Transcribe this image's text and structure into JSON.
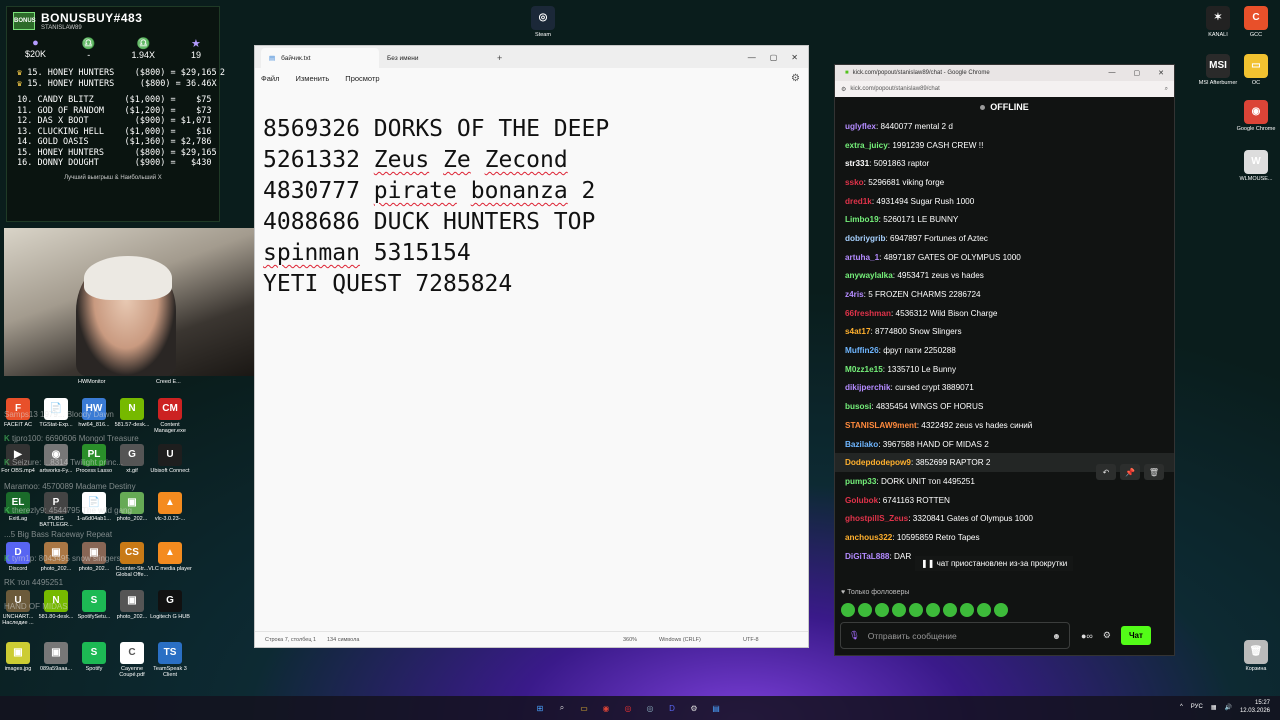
{
  "overlay": {
    "title": "BONUSBUY#483",
    "subtitle": "STANISLAW89",
    "logo": "BONUS",
    "stats": [
      {
        "icon": "●",
        "value": "$20K"
      },
      {
        "icon": "♎",
        "value": "-"
      },
      {
        "icon": "♎",
        "value": "1.94X"
      },
      {
        "icon": "★",
        "value": "19"
      }
    ],
    "best_lines": [
      "15. HONEY HUNTERS    ($800) = $29,165",
      "15. HONEY HUNTERS     ($800) = 36.46X"
    ],
    "best_marker": "2",
    "list_lines": [
      "10. CANDY BLITZ      ($1,000) =    $75",
      "11. GOD OF RANDOM    ($1,200) =    $73",
      "12. DAS X BOOT         ($900) = $1,071",
      "13. CLUCKING HELL    ($1,000) =    $16",
      "14. GOLD OASIS       ($1,360) = $2,786",
      "15. HONEY HUNTERS      ($800) = $29,165",
      "16. DONNY DOUGHT       ($900) =   $430"
    ],
    "footer": "Лучший выигрыш & Наибольший X"
  },
  "desktop_left": {
    "top_labels": [
      "HWMonitor",
      "Creed E..."
    ],
    "icons": [
      {
        "label": "FACEIT AC",
        "glyph": "F",
        "color": "#e8502a"
      },
      {
        "label": "TGStat-Exp...",
        "glyph": "📄",
        "color": "#ffffff"
      },
      {
        "label": "hwi64_816...",
        "glyph": "HW",
        "color": "#3a7bd5"
      },
      {
        "label": "581.57-desk...",
        "glyph": "N",
        "color": "#76b900"
      },
      {
        "label": "Content Manager.exe",
        "glyph": "CM",
        "color": "#c22"
      },
      {
        "label": "For OBS.mp4",
        "glyph": "▶",
        "color": "#333"
      },
      {
        "label": "artworks-Fy...",
        "glyph": "◉",
        "color": "#777"
      },
      {
        "label": "Process Lasso",
        "glyph": "PL",
        "color": "#2a8f2a"
      },
      {
        "label": "xt.gif",
        "glyph": "G",
        "color": "#555"
      },
      {
        "label": "Ubisoft Connect",
        "glyph": "U",
        "color": "#1e1e1e"
      },
      {
        "label": "ExitLag",
        "glyph": "EL",
        "color": "#1a6b2a"
      },
      {
        "label": "PUBG BATTLEGR...",
        "glyph": "P",
        "color": "#444"
      },
      {
        "label": "1-a6d04ab1...",
        "glyph": "📄",
        "color": "#ffffff"
      },
      {
        "label": "photo_202...",
        "glyph": "▣",
        "color": "#6a5"
      },
      {
        "label": "vlc-3.0.23-...",
        "glyph": "▲",
        "color": "#f48b1f"
      },
      {
        "label": "Discord",
        "glyph": "D",
        "color": "#5865f2"
      },
      {
        "label": "photo_202...",
        "glyph": "▣",
        "color": "#a74"
      },
      {
        "label": "photo_202...",
        "glyph": "▣",
        "color": "#865"
      },
      {
        "label": "Counter-Str... Global Offe...",
        "glyph": "CS",
        "color": "#c87a16"
      },
      {
        "label": "VLC media player",
        "glyph": "▲",
        "color": "#f48b1f"
      },
      {
        "label": "UNCHART... Наследие ...",
        "glyph": "U",
        "color": "#6b5a3a"
      },
      {
        "label": "581.80-desk...",
        "glyph": "N",
        "color": "#76b900"
      },
      {
        "label": "SpotifySetu...",
        "glyph": "S",
        "color": "#1db954"
      },
      {
        "label": "photo_202...",
        "glyph": "▣",
        "color": "#555"
      },
      {
        "label": "Logitech G HUB",
        "glyph": "G",
        "color": "#111"
      },
      {
        "label": "images.jpg",
        "glyph": "▣",
        "color": "#cc3"
      },
      {
        "label": "089a59aaa...",
        "glyph": "▣",
        "color": "#777"
      },
      {
        "label": "Spotify",
        "glyph": "S",
        "color": "#1db954"
      },
      {
        "label": "Cayenne Coupé.pdf",
        "glyph": "C",
        "color": "#fff"
      },
      {
        "label": "TeamSpeak 3 Client",
        "glyph": "TS",
        "color": "#2a6fc4"
      }
    ],
    "ghost_chat": [
      {
        "u": "",
        "t": "Samps13 1979... Bloody Dawn"
      },
      {
        "u": "K",
        "t": "tjpro100: 6690606 Mongol Treasure"
      },
      {
        "u": "K",
        "t": "Seizure: ...8314 Twilight princ..."
      },
      {
        "u": "",
        "t": "Maramoo: 4570089 Madame Destiny"
      },
      {
        "u": "K",
        "t": "therezly9: 4544795 The wild gang"
      },
      {
        "u": "",
        "t": "...5 Big Bass Raceway Repeat"
      },
      {
        "u": "K",
        "t": "tyrn1p: 8043495 snow slingers"
      },
      {
        "u": "",
        "t": "RK топ 4495251"
      },
      {
        "u": "",
        "t": "HAND OF MIDAS"
      }
    ],
    "steam_label": "Steam"
  },
  "notepad": {
    "tabs": [
      {
        "label": "байчик.txt"
      },
      {
        "label": "Без имени"
      }
    ],
    "add_tab": "+",
    "menu": [
      "Файл",
      "Изменить",
      "Просмотр"
    ],
    "lines": [
      {
        "pre": "8569326 DORKS OF THE DEEP",
        "sq": []
      },
      {
        "pre": "5261332 ",
        "sq": [
          "Zeus",
          " ",
          "Ze",
          " ",
          "Zecond"
        ]
      },
      {
        "pre": "4830777 ",
        "sq": [
          "pirate",
          " ",
          "bonanza"
        ],
        "post": " 2"
      },
      {
        "pre": "4088686 DUCK HUNTERS TOP",
        "sq": []
      },
      {
        "pre": "",
        "sq": [
          "spinman"
        ],
        "post": " 5315154"
      },
      {
        "pre": "YETI QUEST 7285824",
        "sq": []
      }
    ],
    "status": {
      "position": "Строка 7, столбец 1",
      "chars": "134 символа",
      "zoom": "360%",
      "eol": "Windows (CRLF)",
      "enc": "UTF-8"
    }
  },
  "chrome": {
    "title": "kick.com/popout/stanislaw89/chat - Google Chrome",
    "url": "kick.com/popout/stanislaw89/chat",
    "status": "OFFLINE",
    "messages": [
      {
        "user": "uglyflex",
        "color": "#b48bff",
        "text": "8440077 mental 2 d"
      },
      {
        "user": "extra_juicy",
        "color": "#75f07a",
        "text": "1991239 CASH CREW !!"
      },
      {
        "user": "str331",
        "color": "#ffffff",
        "text": "5091863 raptor"
      },
      {
        "user": "ssko",
        "color": "#e0334a",
        "text": "5296681 viking forge"
      },
      {
        "user": "dred1k",
        "color": "#e0334a",
        "text": "4931494 Sugar Rush 1000"
      },
      {
        "user": "Limbo19",
        "color": "#75f07a",
        "text": "5260171 LE BUNNY"
      },
      {
        "user": "dobriygrib",
        "color": "#a7d1ff",
        "text": "6947897 Fortunes of Aztec"
      },
      {
        "user": "artuha_1",
        "color": "#b48bff",
        "text": "4897187 GATES OF OLYMPUS 1000"
      },
      {
        "user": "anywaylalka",
        "color": "#75f07a",
        "text": "4953471 zeus vs hades"
      },
      {
        "user": "z4ris",
        "color": "#b48bff",
        "text": "5 FROZEN CHARMS 2286724"
      },
      {
        "user": "66freshman",
        "color": "#e0334a",
        "text": "4536312 Wild Bison Charge"
      },
      {
        "user": "s4at17",
        "color": "#ffb02e",
        "text": "8774800 Snow Slingers"
      },
      {
        "user": "Muffin26",
        "color": "#6fb6ff",
        "text": "фрут пати 2250288"
      },
      {
        "user": "M0zz1e15",
        "color": "#75f07a",
        "text": "1335710 Le Bunny"
      },
      {
        "user": "dikijperchik",
        "color": "#b48bff",
        "text": "cursed crypt 3889071"
      },
      {
        "user": "busosi",
        "color": "#75f07a",
        "text": "4835454 WINGS OF HORUS"
      },
      {
        "user": "STANISLAW9ment",
        "color": "#ff8a3d",
        "text": "4322492 zeus vs hades синий"
      },
      {
        "user": "Bazilako",
        "color": "#6fb6ff",
        "text": "3967588 HAND OF MIDAS 2"
      },
      {
        "user": "Dodepdodepow9",
        "color": "#ffb02e",
        "text": "3852699 RAPTOR 2"
      },
      {
        "user": "pump33",
        "color": "#75f07a",
        "text": "DORK UNIT топ 4495251"
      },
      {
        "user": "Golubok",
        "color": "#e0334a",
        "text": "6741163 ROTTEN"
      },
      {
        "user": "ghostpillS_Zeus",
        "color": "#e0334a",
        "text": "3320841 Gates of Olympus 1000"
      },
      {
        "user": "anchous322",
        "color": "#ffb02e",
        "text": "10595859 Retro Tapes"
      },
      {
        "user": "DiGiTaL888",
        "color": "#b48bff",
        "text": "DAR"
      }
    ],
    "paused": "чат приостановлен из-за прокрутки",
    "followers": "Только фолловеры",
    "input_placeholder": "Отправить сообщение",
    "send_label": "Чат"
  },
  "desktop_right": [
    {
      "label": "KANALI",
      "glyph": "✶",
      "color": "#222"
    },
    {
      "label": "GCC",
      "glyph": "C",
      "color": "#e8502a"
    },
    {
      "label": "MSI Afterburner",
      "glyph": "MSI",
      "color": "#2a2a2a"
    },
    {
      "label": "ОС",
      "glyph": "▭",
      "color": "#f2c230"
    },
    {
      "label": "Google Chrome",
      "glyph": "◉",
      "color": "#db4437"
    },
    {
      "label": "WLMOUSE...",
      "glyph": "W",
      "color": "#ddd"
    },
    {
      "label": "Корзина",
      "glyph": "🗑",
      "color": "#bbb"
    }
  ],
  "taskbar": {
    "lang": "РУС",
    "time": "15:27",
    "date": "12.03.2026"
  }
}
